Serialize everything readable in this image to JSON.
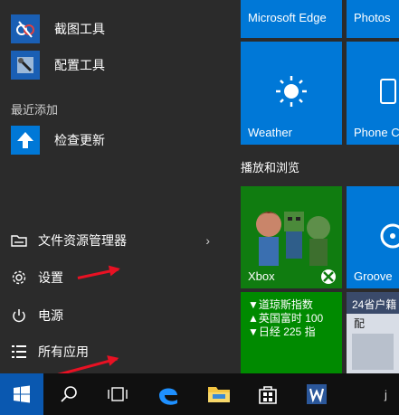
{
  "apps": [
    {
      "label": "截图工具",
      "icon": "snipping-tool-icon"
    },
    {
      "label": "配置工具",
      "icon": "config-tool-icon"
    }
  ],
  "recent_section": "最近添加",
  "recent_apps": [
    {
      "label": "检查更新",
      "icon": "update-arrow-icon"
    }
  ],
  "system_items": {
    "explorer": "文件资源管理器",
    "settings": "设置",
    "power": "电源",
    "all_apps": "所有应用"
  },
  "tiles": {
    "edge": "Microsoft Edge",
    "photos": "Photos",
    "weather": "Weather",
    "phone": "Phone C",
    "group_label": "播放和浏览",
    "xbox": "Xbox",
    "groove": "Groove",
    "finance": [
      "▼道琼斯指数",
      "▲英国富时 100",
      "▼日经 225 指"
    ],
    "news": "24省户籍",
    "news2": "配"
  },
  "colors": {
    "accent": "#0078d7",
    "xbox_green": "#107c10",
    "finance_green": "#008a00",
    "arrow_red": "#e81123"
  }
}
